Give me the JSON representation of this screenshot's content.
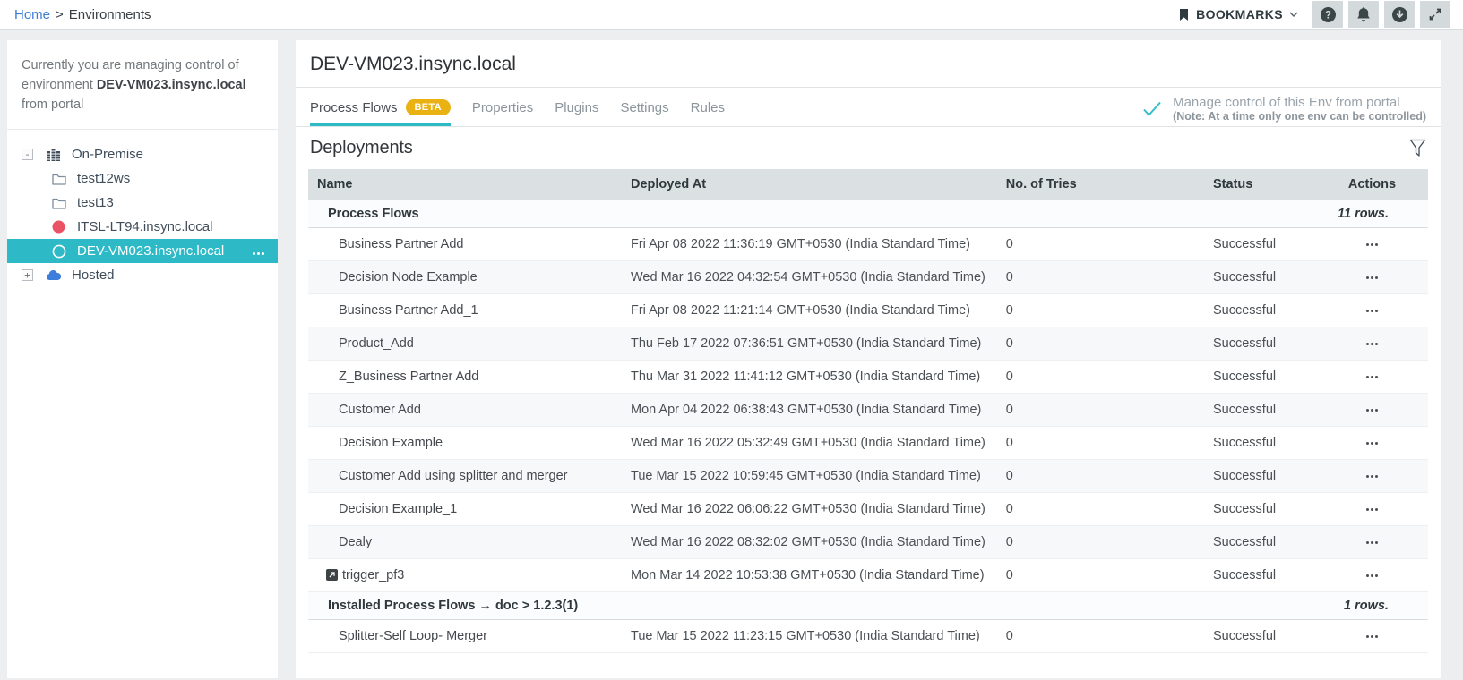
{
  "breadcrumb": {
    "home": "Home",
    "separator": ">",
    "current": "Environments"
  },
  "topbar": {
    "bookmarks_label": "BOOKMARKS",
    "icons": [
      "help-icon",
      "bell-icon",
      "download-icon",
      "expand-icon"
    ]
  },
  "sidebar": {
    "notice": {
      "prefix": "Currently you are managing control of environment",
      "env": "DEV-VM023.insync.local",
      "suffix": "from portal"
    },
    "tree": [
      {
        "label": "On-Premise",
        "icon": "building-icon",
        "expander": "-",
        "level": 0
      },
      {
        "label": "test12ws",
        "icon": "folder-icon",
        "level": 1
      },
      {
        "label": "test13",
        "icon": "folder-icon",
        "level": 1
      },
      {
        "label": "ITSL-LT94.insync.local",
        "icon": "red-dot-icon",
        "level": 1
      },
      {
        "label": "DEV-VM023.insync.local",
        "icon": "circle-outline-icon",
        "level": 1,
        "selected": true,
        "has_menu": true
      },
      {
        "label": "Hosted",
        "icon": "cloud-icon",
        "expander": "+",
        "level": 0
      }
    ]
  },
  "main": {
    "title": "DEV-VM023.insync.local",
    "tabs": [
      {
        "label": "Process Flows",
        "badge": "BETA",
        "active": true
      },
      {
        "label": "Properties"
      },
      {
        "label": "Plugins"
      },
      {
        "label": "Settings"
      },
      {
        "label": "Rules"
      }
    ],
    "portal_control": {
      "line1": "Manage control of this Env from portal",
      "line2": "(Note: At a time only one env can be controlled)"
    },
    "section_title": "Deployments",
    "table": {
      "columns": [
        "Name",
        "Deployed At",
        "No. of Tries",
        "Status",
        "Actions"
      ],
      "groups": [
        {
          "header": "Process Flows",
          "count": "11 rows.",
          "rows": [
            {
              "name": "Business Partner Add",
              "deployed_at": "Fri Apr 08 2022 11:36:19 GMT+0530 (India Standard Time)",
              "tries": "0",
              "status": "Successful"
            },
            {
              "name": "Decision Node Example",
              "deployed_at": "Wed Mar 16 2022 04:32:54 GMT+0530 (India Standard Time)",
              "tries": "0",
              "status": "Successful"
            },
            {
              "name": "Business Partner Add_1",
              "deployed_at": "Fri Apr 08 2022 11:21:14 GMT+0530 (India Standard Time)",
              "tries": "0",
              "status": "Successful"
            },
            {
              "name": "Product_Add",
              "deployed_at": "Thu Feb 17 2022 07:36:51 GMT+0530 (India Standard Time)",
              "tries": "0",
              "status": "Successful"
            },
            {
              "name": "Z_Business Partner Add",
              "deployed_at": "Thu Mar 31 2022 11:41:12 GMT+0530 (India Standard Time)",
              "tries": "0",
              "status": "Successful"
            },
            {
              "name": "Customer Add",
              "deployed_at": "Mon Apr 04 2022 06:38:43 GMT+0530 (India Standard Time)",
              "tries": "0",
              "status": "Successful"
            },
            {
              "name": "Decision Example",
              "deployed_at": "Wed Mar 16 2022 05:32:49 GMT+0530 (India Standard Time)",
              "tries": "0",
              "status": "Successful"
            },
            {
              "name": "Customer Add using splitter and merger",
              "deployed_at": "Tue Mar 15 2022 10:59:45 GMT+0530 (India Standard Time)",
              "tries": "0",
              "status": "Successful"
            },
            {
              "name": "Decision Example_1",
              "deployed_at": "Wed Mar 16 2022 06:06:22 GMT+0530 (India Standard Time)",
              "tries": "0",
              "status": "Successful"
            },
            {
              "name": "Dealy",
              "deployed_at": "Wed Mar 16 2022 08:32:02 GMT+0530 (India Standard Time)",
              "tries": "0",
              "status": "Successful"
            },
            {
              "name": "trigger_pf3",
              "name_icon": "trigger-icon",
              "deployed_at": "Mon Mar 14 2022 10:53:38 GMT+0530 (India Standard Time)",
              "tries": "0",
              "status": "Successful"
            }
          ]
        },
        {
          "header": "Installed Process Flows → doc > 1.2.3(1)",
          "count": "1 rows.",
          "rows": [
            {
              "name": "Splitter-Self Loop- Merger",
              "deployed_at": "Tue Mar 15 2022 11:23:15 GMT+0530 (India Standard Time)",
              "tries": "0",
              "status": "Successful"
            }
          ]
        }
      ]
    },
    "colors": {
      "accent_teal": "#2dbac6",
      "badge_gold": "#eab112",
      "error_red": "#ea5365",
      "hosted_blue": "#3d7edd"
    }
  }
}
